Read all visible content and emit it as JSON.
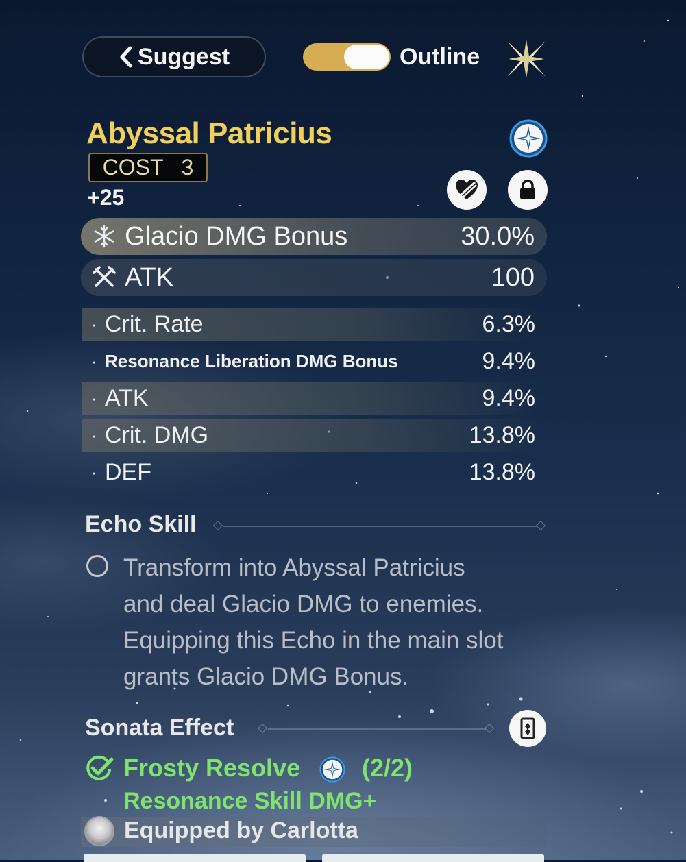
{
  "topbar": {
    "suggest_label": "Suggest",
    "outline_label": "Outline",
    "outline_toggle_on": true
  },
  "echo": {
    "name": "Abyssal Patricius",
    "cost_label": "COST",
    "cost_value": "3",
    "level": "+25",
    "element": "Glacio"
  },
  "main_stats": [
    {
      "icon": "snowflake-icon",
      "name": "Glacio DMG Bonus",
      "value": "30.0%"
    },
    {
      "icon": "crossed-swords-icon",
      "name": "ATK",
      "value": "100"
    }
  ],
  "sub_stats": [
    {
      "name": "Crit. Rate",
      "value": "6.3%"
    },
    {
      "name": "Resonance Liberation DMG Bonus",
      "value": "9.4%"
    },
    {
      "name": "ATK",
      "value": "9.4%"
    },
    {
      "name": "Crit. DMG",
      "value": "13.8%"
    },
    {
      "name": "DEF",
      "value": "13.8%"
    }
  ],
  "echo_skill": {
    "title": "Echo Skill",
    "lines": [
      "Transform into Abyssal Patricius",
      "and deal Glacio DMG to enemies.",
      "Equipping this Echo in the main slot",
      "grants Glacio DMG Bonus."
    ]
  },
  "sonata": {
    "title": "Sonata Effect",
    "set_name": "Frosty Resolve",
    "count": "(2/2)",
    "effect": "Resonance Skill DMG+"
  },
  "equipped": {
    "text": "Equipped by Carlotta"
  },
  "colors": {
    "gold_title": "#f0d05a",
    "sonata_green": "#7fe36f",
    "toggle_gold": "#d6ad52",
    "glacio_blue": "#2f8fe0"
  }
}
